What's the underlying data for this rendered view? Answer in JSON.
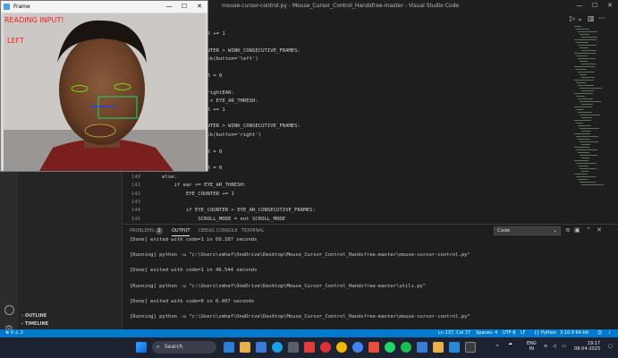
{
  "vscode": {
    "title": "mouse-cursor-control.py - Mouse_Cursor_Control_Handsfree-master - Visual Studio Code",
    "sidebar": {
      "outline": "OUTLINE",
      "timeline": "TIMELINE"
    },
    "code_lines": [
      {
        "n": "",
        "text": "    WINK_COUNTER += 1"
      },
      {
        "n": "",
        "text": ""
      },
      {
        "n": "",
        "text": "    if WINK_COUNTER > WINK_CONSECUTIVE_FRAMES:"
      },
      {
        "n": "",
        "text": "        pag.click(button='left')"
      },
      {
        "n": "",
        "text": ""
      },
      {
        "n": "",
        "text": "    WINK_COUNTER = 0"
      },
      {
        "n": "",
        "text": ""
      },
      {
        "n": "",
        "text": "elif leftEAR > rightEAR:"
      },
      {
        "n": "",
        "text": "    if rightEAR < EYE_AR_THRESH:"
      },
      {
        "n": "",
        "text": "    WINK_COUNTER += 1"
      },
      {
        "n": "",
        "text": ""
      },
      {
        "n": "",
        "text": "    if WINK_COUNTER > WINK_CONSECUTIVE_FRAMES:"
      },
      {
        "n": "",
        "text": "        pag.click(button='right')"
      },
      {
        "n": "",
        "text": ""
      },
      {
        "n": "",
        "text": "    WINK_COUNTER = 0"
      },
      {
        "n": "",
        "text": ""
      },
      {
        "n": "",
        "text": "    WINK_COUNTER = 0"
      },
      {
        "n": "140",
        "text": "else:"
      },
      {
        "n": "141",
        "text": "    if ear <= EYE_AR_THRESH:"
      },
      {
        "n": "142",
        "text": "        EYE_COUNTER += 1"
      },
      {
        "n": "143",
        "text": ""
      },
      {
        "n": "144",
        "text": "        if EYE_COUNTER > EYE_AR_CONSECUTIVE_FRAMES:"
      },
      {
        "n": "145",
        "text": "            SCROLL_MODE = not SCROLL_MODE"
      }
    ],
    "panel": {
      "tabs": [
        "PROBLEMS",
        "OUTPUT",
        "DEBUG CONSOLE",
        "TERMINAL"
      ],
      "problems_count": "2",
      "output_channel": "Code",
      "output_lines": [
        "[Done] exited with code=1 in 60.107 seconds",
        "",
        "[Running] python -u \"c:\\Users\\smhaf\\OneDrive\\Desktop\\Mouse_Cursor_Control_Handsfree-master\\mouse-cursor-control.py\"",
        "",
        "[Done] exited with code=1 in 46.544 seconds",
        "",
        "[Running] python -u \"c:\\Users\\smhaf\\OneDrive\\Desktop\\Mouse_Cursor_Control_Handsfree-master\\utils.py\"",
        "",
        "[Done] exited with code=0 in 0.407 seconds",
        "",
        "[Running] python -u \"c:\\Users\\smhaf\\OneDrive\\Desktop\\Mouse_Cursor_Control_Handsfree-master\\mouse-cursor-control.py\""
      ]
    },
    "statusbar": {
      "problems": "⊗ 0 ⚠ 2",
      "position": "Ln 137, Col 37",
      "spaces": "Spaces: 4",
      "encoding": "UTF-8",
      "eol": "LF",
      "language": "{} Python",
      "interpreter": "3.10.9 64-bit"
    }
  },
  "frame": {
    "title": "Frame",
    "overlay_line1": "READING INPUT!",
    "overlay_line2": "LEFT"
  },
  "taskbar": {
    "search_label": "Search",
    "language_line1": "ENG",
    "language_line2": "IN",
    "time": "19:17",
    "date": "09-04-2023"
  },
  "colors": {
    "statusbar": "#007acc",
    "overlay_text": "#ff1a1a",
    "eye_outline": "#7CFC00",
    "nose_box": "#22c55e"
  }
}
